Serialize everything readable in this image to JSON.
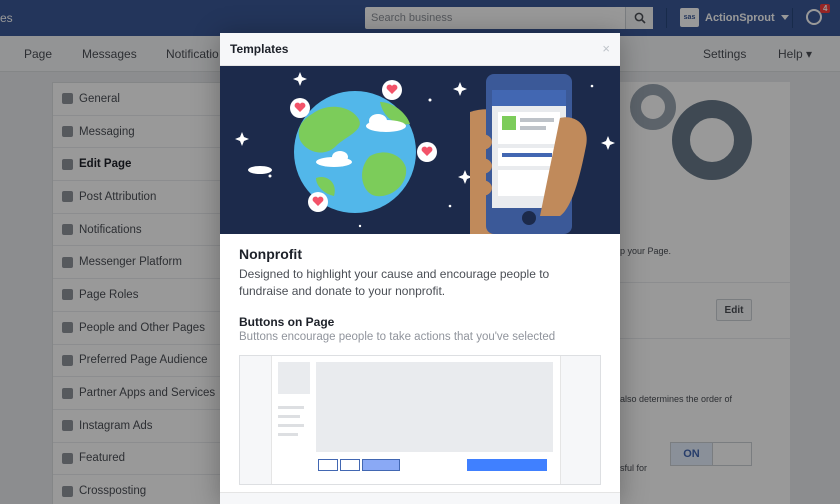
{
  "topbar": {
    "left_fragment": "es",
    "search_placeholder": "Search business",
    "account_name": "ActionSprout",
    "account_avatar_text": "sas",
    "notification_count": "4"
  },
  "pagenav": {
    "items": [
      "Page",
      "Messages",
      "Notificatio",
      "Settings",
      "Help ▾"
    ]
  },
  "sidebar": {
    "items": [
      {
        "label": "General",
        "icon": "gear-icon"
      },
      {
        "label": "Messaging",
        "icon": "message-icon"
      },
      {
        "label": "Edit Page",
        "icon": "pencil-icon",
        "active": true
      },
      {
        "label": "Post Attribution",
        "icon": "flag-icon"
      },
      {
        "label": "Notifications",
        "icon": "globe-icon"
      },
      {
        "label": "Messenger Platform",
        "icon": "messenger-icon"
      },
      {
        "label": "Page Roles",
        "icon": "person-icon"
      },
      {
        "label": "People and Other Pages",
        "icon": "people-icon"
      },
      {
        "label": "Preferred Page Audience",
        "icon": "people-icon"
      },
      {
        "label": "Partner Apps and Services",
        "icon": "handshake-icon"
      },
      {
        "label": "Instagram Ads",
        "icon": "instagram-icon"
      },
      {
        "label": "Featured",
        "icon": "star-icon"
      },
      {
        "label": "Crossposting",
        "icon": "video-icon"
      }
    ]
  },
  "right_panel": {
    "text1": "p your Page.",
    "edit_label": "Edit",
    "text2": "also determines the order of",
    "toggle_on_label": "ON",
    "text3": "sful for"
  },
  "modal": {
    "title": "Templates",
    "close_glyph": "×",
    "template_name": "Nonprofit",
    "template_description": "Designed to highlight your cause and encourage people to fundraise and donate to your nonprofit.",
    "section_title": "Buttons on Page",
    "section_description": "Buttons encourage people to take actions that you've selected"
  },
  "colors": {
    "brand": "#3b5998",
    "hero_bg": "#1c2a4b",
    "cta": "#4080ff"
  }
}
